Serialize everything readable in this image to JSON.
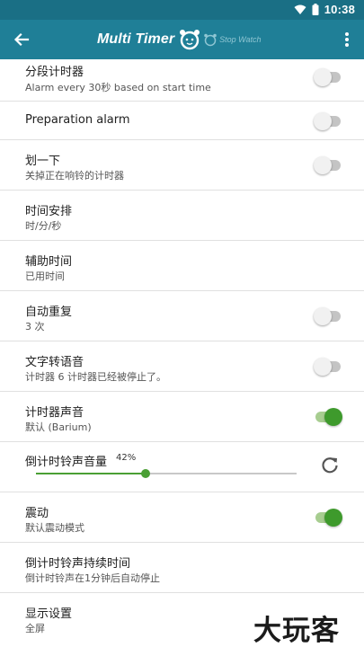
{
  "status_bar": {
    "time": "10:38"
  },
  "app_bar": {
    "back_icon": "arrow-back-icon",
    "title": "Multi Timer",
    "subtitle": "Stop Watch",
    "menu_icon": "more-vert-icon"
  },
  "colors": {
    "app_bar": "#1f7f97",
    "status_bar": "#1a6f85",
    "accent": "#3e9a2c"
  },
  "settings": [
    {
      "title": "分段计时器",
      "subtitle": "Alarm every 30秒 based on start time",
      "switch": false
    },
    {
      "title": "Preparation alarm",
      "switch": false
    },
    {
      "title": "划一下",
      "subtitle": "关掉正在响铃的计时器",
      "switch": false
    },
    {
      "title": "时间安排",
      "subtitle": "时/分/秒"
    },
    {
      "title": "辅助时间",
      "subtitle": "已用时间"
    },
    {
      "title": "自动重复",
      "subtitle": "3 次",
      "switch": false
    },
    {
      "title": "文字转语音",
      "subtitle": "计时器 6 计时器已经被停止了。",
      "switch": false
    },
    {
      "title": "计时器声音",
      "subtitle": "默认 (Barium)",
      "switch": true
    },
    {
      "title": "倒计时铃声音量",
      "value_text": "42%",
      "value": 0.42,
      "reset_icon": "refresh-icon"
    },
    {
      "title": "震动",
      "subtitle": "默认震动模式",
      "switch": true
    },
    {
      "title": "倒计时铃声持续时间",
      "subtitle": "倒计时铃声在1分钟后自动停止"
    },
    {
      "title": "显示设置",
      "subtitle": "全屏"
    }
  ],
  "watermark": "大玩客"
}
